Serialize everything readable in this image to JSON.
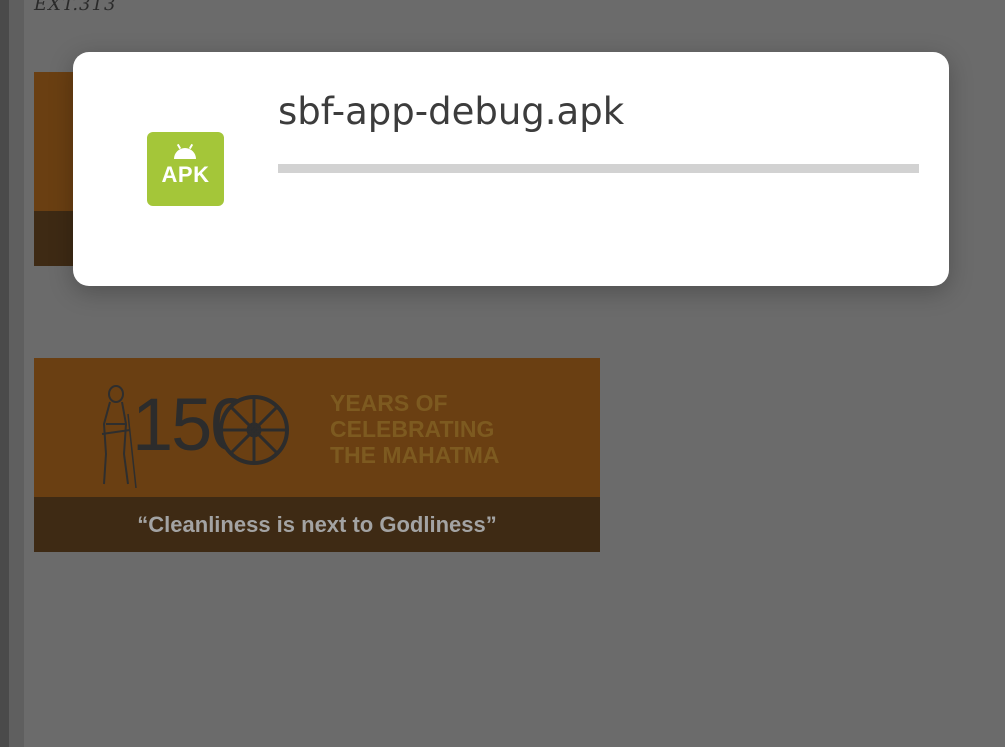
{
  "background_page": {
    "top_text": "EXT.313",
    "banners": [
      {
        "number": "150",
        "headline": [
          "YEARS OF",
          "CELEBRATING",
          "THE MAHATMA"
        ],
        "quote": "“Cleanliness is next to Godliness”"
      }
    ]
  },
  "download_dialog": {
    "icon": {
      "name": "apk-file-icon",
      "label": "APK",
      "color": "#a4c639"
    },
    "file_name": "sbf-app-debug.apk",
    "progress": 0
  }
}
